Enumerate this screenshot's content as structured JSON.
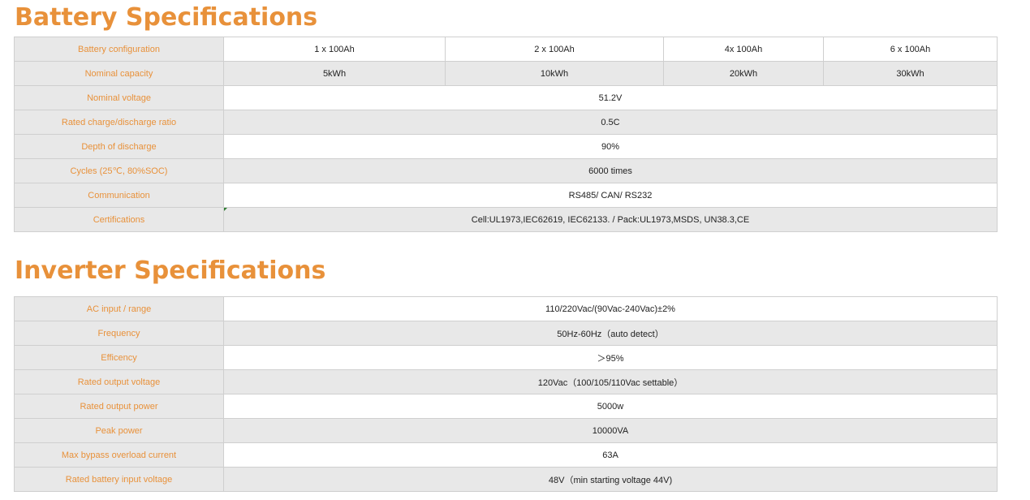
{
  "battery": {
    "title": "Battery Specifications",
    "rows": [
      {
        "label": "Battery configuration",
        "values": [
          "1 x 100Ah",
          "2 x 100Ah",
          "4x 100Ah",
          "6 x 100Ah"
        ]
      },
      {
        "label": "Nominal capacity",
        "values": [
          "5kWh",
          "10kWh",
          "20kWh",
          "30kWh"
        ]
      },
      {
        "label": "Nominal voltage",
        "value": "51.2V"
      },
      {
        "label": "Rated charge/discharge ratio",
        "value": "0.5C"
      },
      {
        "label": "Depth of discharge",
        "value": "90%"
      },
      {
        "label": "Cycles (25℃, 80%SOC)",
        "value": "6000 times"
      },
      {
        "label": "Communication",
        "value": "RS485/ CAN/ RS232"
      },
      {
        "label": "Certifications",
        "value": "Cell:UL1973,IEC62619, IEC62133. /   Pack:UL1973,MSDS, UN38.3,CE"
      }
    ]
  },
  "inverter": {
    "title": "Inverter Specifications",
    "rows": [
      {
        "label": "AC input / range",
        "value": "110/220Vac/(90Vac-240Vac)±2%"
      },
      {
        "label": "Frequency",
        "value": "50Hz-60Hz（auto detect）"
      },
      {
        "label": "Efficency",
        "value": "＞95%"
      },
      {
        "label": "Rated output voltage",
        "value": "120Vac（100/105/110Vac settable）"
      },
      {
        "label": "Rated output power",
        "value": "5000w"
      },
      {
        "label": "Peak power",
        "value": "10000VA"
      },
      {
        "label": "Max bypass overload current",
        "value": "63A"
      },
      {
        "label": "Rated battery input voltage",
        "value": "48V（min starting voltage 44V)"
      }
    ]
  },
  "colors": {
    "accent": "#E8913A",
    "shade": "#e8e8e8",
    "border": "#cfcfcf"
  }
}
